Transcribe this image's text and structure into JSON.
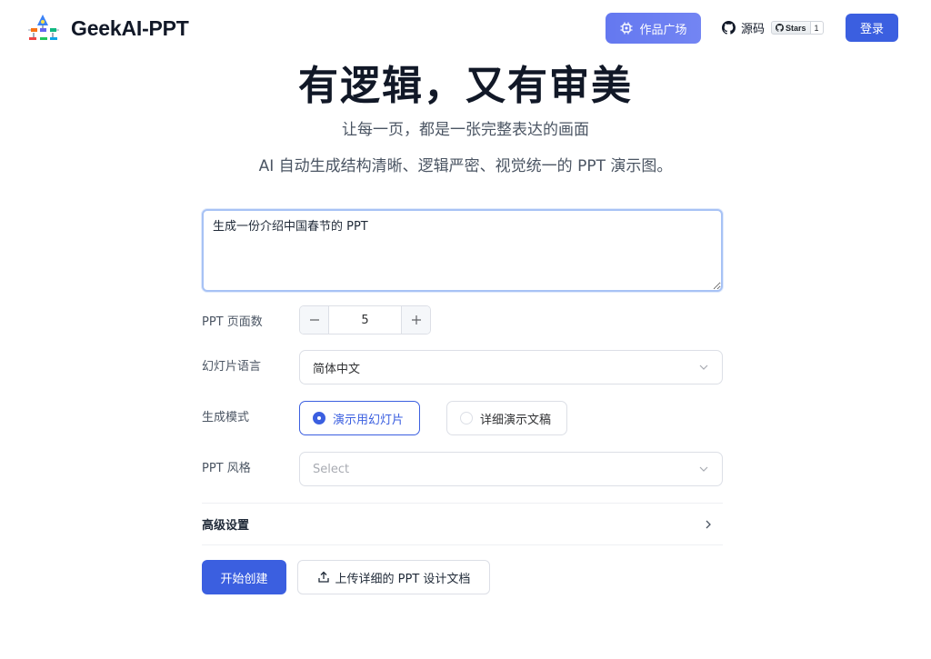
{
  "header": {
    "logo_text": "GeekAI-PPT",
    "logo_icon": "flowchart-logo",
    "gallery_label": "作品广场",
    "gallery_icon": "chip-icon",
    "source_label": "源码",
    "stars_label": "Stars",
    "stars_count": "1",
    "login_label": "登录"
  },
  "hero": {
    "title": "有逻辑，又有审美",
    "subtitle": "让每一页，都是一张完整表达的画面",
    "description": "AI 自动生成结构清晰、逻辑严密、视觉统一的 PPT 演示图。"
  },
  "form": {
    "prompt_value": "生成一份介绍中国春节的 PPT",
    "page_count_label": "PPT 页面数",
    "page_count_value": "5",
    "language_label": "幻灯片语言",
    "language_value": "简体中文",
    "mode_label": "生成模式",
    "modes": [
      {
        "label": "演示用幻灯片",
        "selected": true
      },
      {
        "label": "详细演示文稿",
        "selected": false
      }
    ],
    "style_label": "PPT 风格",
    "style_placeholder": "Select",
    "advanced_label": "高级设置",
    "start_label": "开始创建",
    "upload_label": "上传详细的 PPT 设计文档"
  },
  "colors": {
    "primary": "#3b5fe0",
    "gallery_gradient_start": "#6478f0",
    "gallery_gradient_end": "#7385f3",
    "textarea_border": "#a7c2f5"
  }
}
